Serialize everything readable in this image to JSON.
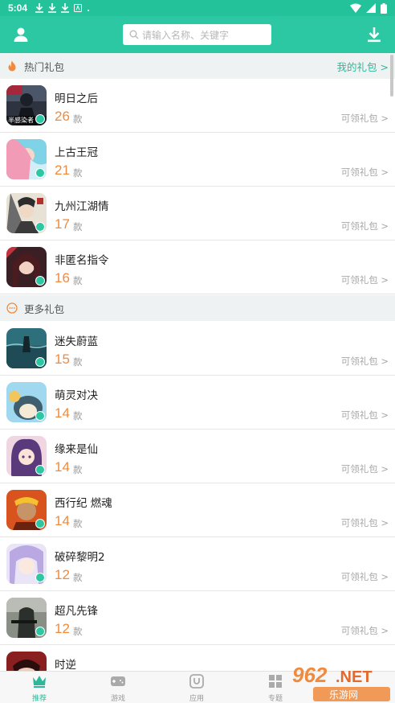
{
  "status_bar": {
    "time": "5:04"
  },
  "search": {
    "placeholder": "请输入名称、关键字"
  },
  "hot_section": {
    "title": "热门礼包",
    "my_gifts": "我的礼包 >"
  },
  "more_section": {
    "title": "更多礼包"
  },
  "hot_games": [
    {
      "name": "明日之后",
      "count": "26",
      "unit": "款",
      "action": "可领礼包 >",
      "art_text": "半感染者"
    },
    {
      "name": "上古王冠",
      "count": "21",
      "unit": "款",
      "action": "可领礼包 >"
    },
    {
      "name": "九州江湖情",
      "count": "17",
      "unit": "款",
      "action": "可领礼包 >"
    },
    {
      "name": "非匿名指令",
      "count": "16",
      "unit": "款",
      "action": "可领礼包 >"
    }
  ],
  "more_games": [
    {
      "name": "迷失蔚蓝",
      "count": "15",
      "unit": "款",
      "action": "可领礼包 >"
    },
    {
      "name": "萌灵对决",
      "count": "14",
      "unit": "款",
      "action": "可领礼包 >"
    },
    {
      "name": "缘来是仙",
      "count": "14",
      "unit": "款",
      "action": "可领礼包 >"
    },
    {
      "name": "西行纪 燃魂",
      "count": "14",
      "unit": "款",
      "action": "可领礼包 >"
    },
    {
      "name": "破碎黎明2",
      "count": "12",
      "unit": "款",
      "action": "可领礼包 >"
    },
    {
      "name": "超凡先锋",
      "count": "12",
      "unit": "款",
      "action": "可领礼包 >"
    },
    {
      "name": "时逆",
      "count": "",
      "unit": "",
      "action": ""
    }
  ],
  "tabs": [
    {
      "label": "推荐",
      "icon": "crown-icon"
    },
    {
      "label": "游戏",
      "icon": "gamepad-icon"
    },
    {
      "label": "应用",
      "icon": "app-icon"
    },
    {
      "label": "专题",
      "icon": "grid-icon"
    }
  ],
  "watermark": {
    "text": "962.NET",
    "sub": "乐游网"
  },
  "colors": {
    "accent": "#2bc8a3",
    "count": "#f08a3c",
    "link": "#2bb99a"
  }
}
